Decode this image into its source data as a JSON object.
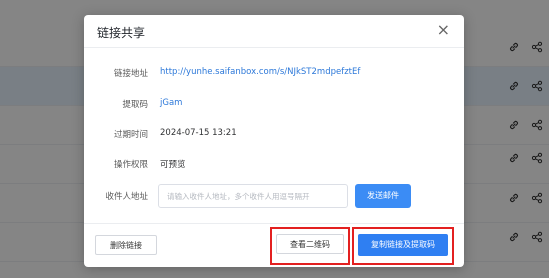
{
  "background": {
    "rows": [
      {
        "link_icon": "link-icon",
        "share_icon": "share-icon"
      },
      {
        "link_icon": "link-icon",
        "share_icon": "share-icon"
      },
      {
        "link_icon": "link-icon",
        "share_icon": "share-icon"
      },
      {
        "link_icon": "link-icon",
        "share_icon": "share-icon"
      },
      {
        "link_icon": "link-icon",
        "share_icon": "share-icon"
      },
      {
        "link_icon": "link-icon",
        "share_icon": "share-icon"
      }
    ]
  },
  "dialog": {
    "title": "链接共享",
    "close_glyph": "×",
    "fields": {
      "link_label": "链接地址",
      "link_value": "http://yunhe.saifanbox.com/s/NJkST2mdpefztEf",
      "code_label": "提取码",
      "code_value": "jGam",
      "expire_label": "过期时间",
      "expire_value": "2024-07-15 13:21",
      "perm_label": "操作权限",
      "perm_value": "可预览",
      "recipient_label": "收件人地址",
      "recipient_placeholder": "请输入收件人地址，多个收件人用逗号隔开",
      "send_label": "发送邮件"
    },
    "footer": {
      "delete_label": "删除链接",
      "qr_label": "查看二维码",
      "copy_label": "复制链接及提取码"
    }
  },
  "colors": {
    "accent": "#3b8cf5",
    "highlight": "#e32020",
    "link_text": "#2c78d9"
  }
}
